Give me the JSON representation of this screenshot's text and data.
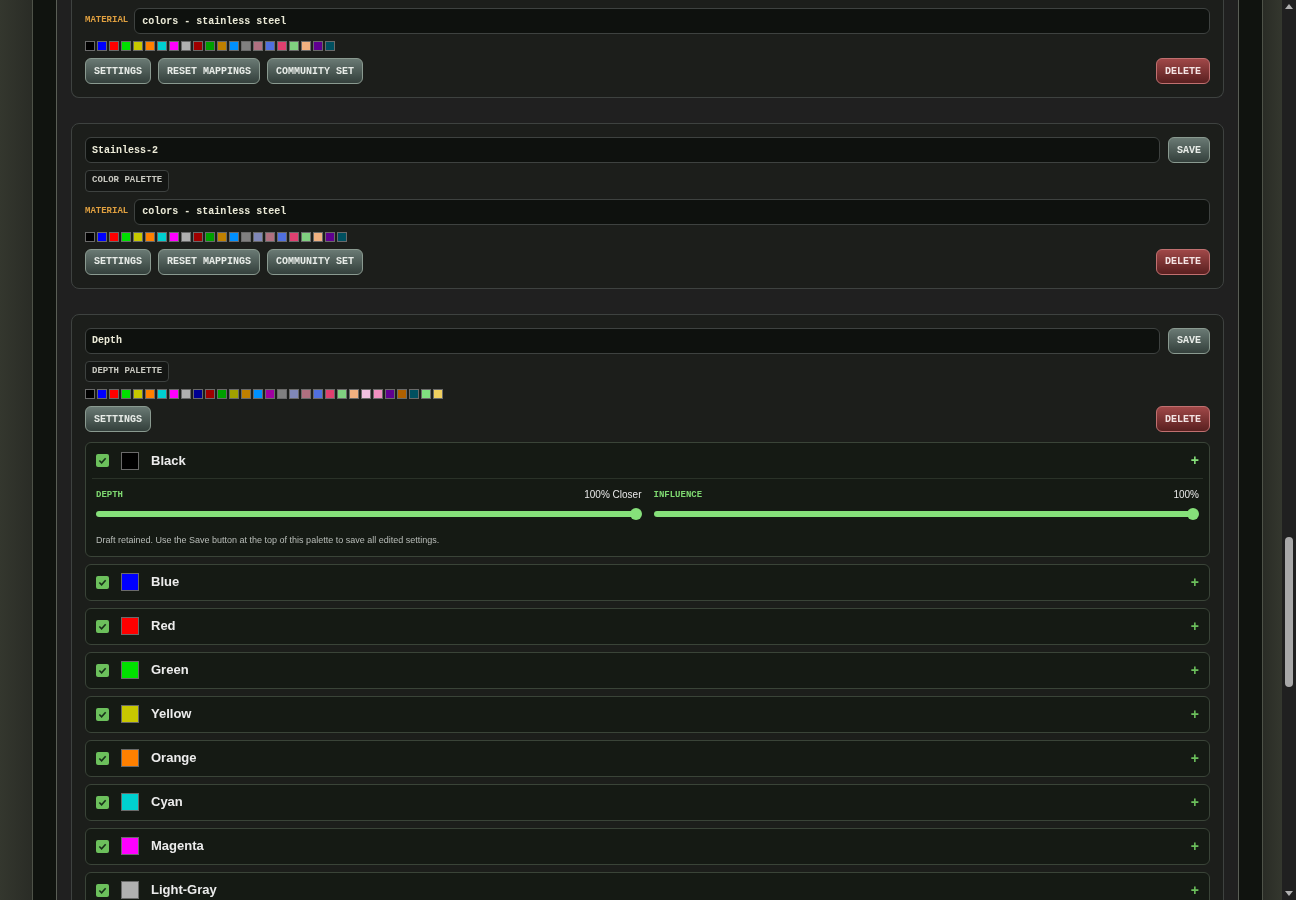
{
  "palettes": [
    {
      "kind": "material",
      "cut_top": true,
      "material_label": "MATERIAL",
      "material_value": "colors - stainless steel",
      "swatches": [
        {
          "color": "#000000"
        },
        {
          "color": "#0000ff"
        },
        {
          "color": "#ff0000"
        },
        {
          "color": "#00e000"
        },
        {
          "color": "#c8c800"
        },
        {
          "color": "#ff8000"
        },
        {
          "color": "#00d0d0"
        },
        {
          "color": "#ff00ff"
        },
        {
          "color": "#b0b0b0"
        },
        {
          "color": "#a00000"
        },
        {
          "color": "#00a000"
        },
        {
          "color": "#c08000"
        },
        {
          "color": "#0090ff"
        },
        {
          "color": "#808080"
        },
        {
          "color": "#b07080"
        },
        {
          "color": "#5070e0"
        },
        {
          "color": "#e04070"
        },
        {
          "color": "#80d080"
        },
        {
          "color": "#f0b080"
        },
        {
          "color": "#600090"
        },
        {
          "color": "#005060"
        }
      ],
      "buttons": [
        "SETTINGS",
        "RESET MAPPINGS",
        "COMMUNITY SET"
      ],
      "delete": "DELETE"
    },
    {
      "kind": "material",
      "cut_top": false,
      "name": "Stainless-2",
      "save": "SAVE",
      "type_label": "COLOR PALETTE",
      "material_label": "MATERIAL",
      "material_value": "colors - stainless steel",
      "swatches": [
        {
          "color": "#000000"
        },
        {
          "color": "#0000ff"
        },
        {
          "color": "#ff0000"
        },
        {
          "color": "#00e000"
        },
        {
          "color": "#c8c800"
        },
        {
          "color": "#ff8000"
        },
        {
          "color": "#00d0d0"
        },
        {
          "color": "#ff00ff"
        },
        {
          "color": "#b0b0b0"
        },
        {
          "color": "#a00000"
        },
        {
          "color": "#00a000"
        },
        {
          "color": "#c08000"
        },
        {
          "color": "#0090ff"
        },
        {
          "color": "#808080"
        },
        {
          "color": "#8088b8"
        },
        {
          "color": "#b07080"
        },
        {
          "color": "#5070e0"
        },
        {
          "color": "#e04070"
        },
        {
          "color": "#80d080"
        },
        {
          "color": "#f0b080"
        },
        {
          "color": "#600090"
        },
        {
          "color": "#005060"
        }
      ],
      "buttons": [
        "SETTINGS",
        "RESET MAPPINGS",
        "COMMUNITY SET"
      ],
      "delete": "DELETE"
    },
    {
      "kind": "depth",
      "cut_top": false,
      "name": "Depth",
      "save": "SAVE",
      "type_label": "DEPTH PALETTE",
      "swatches": [
        {
          "color": "#000000"
        },
        {
          "color": "#0000ff"
        },
        {
          "color": "#ff0000"
        },
        {
          "color": "#00e000"
        },
        {
          "color": "#c8c800"
        },
        {
          "color": "#ff8000"
        },
        {
          "color": "#00d0d0"
        },
        {
          "color": "#ff00ff"
        },
        {
          "color": "#b0b0b0"
        },
        {
          "color": "#000090"
        },
        {
          "color": "#a00000"
        },
        {
          "color": "#00a000"
        },
        {
          "color": "#a0a000"
        },
        {
          "color": "#c08000"
        },
        {
          "color": "#0090ff"
        },
        {
          "color": "#a000a0"
        },
        {
          "color": "#808080"
        },
        {
          "color": "#8088b8"
        },
        {
          "color": "#b07080"
        },
        {
          "color": "#5070e0"
        },
        {
          "color": "#e04070"
        },
        {
          "color": "#80d080"
        },
        {
          "color": "#f0b080"
        },
        {
          "color": "#f0c0e0"
        },
        {
          "color": "#f090c0"
        },
        {
          "color": "#600090"
        },
        {
          "color": "#b06000"
        },
        {
          "color": "#005060"
        },
        {
          "color": "#80e080"
        },
        {
          "color": "#f0d060"
        }
      ],
      "buttons": [
        "SETTINGS"
      ],
      "delete": "DELETE",
      "colors": [
        {
          "name": "Black",
          "color": "#000000",
          "checked": true,
          "expanded": true,
          "toggle": "+",
          "depth": {
            "label": "DEPTH",
            "reading": "100% Closer",
            "level": 1
          },
          "influence": {
            "label": "INFLUENCE",
            "reading": "100%",
            "level": 1
          },
          "note": "Draft retained. Use the Save button at the top of this palette to save all edited settings."
        },
        {
          "name": "Blue",
          "color": "#0000ff",
          "checked": true,
          "expanded": false,
          "toggle": "+"
        },
        {
          "name": "Red",
          "color": "#ff0000",
          "checked": true,
          "expanded": false,
          "toggle": "+"
        },
        {
          "name": "Green",
          "color": "#00e000",
          "checked": true,
          "expanded": false,
          "toggle": "+"
        },
        {
          "name": "Yellow",
          "color": "#c8c800",
          "checked": true,
          "expanded": false,
          "toggle": "+"
        },
        {
          "name": "Orange",
          "color": "#ff8000",
          "checked": true,
          "expanded": false,
          "toggle": "+"
        },
        {
          "name": "Cyan",
          "color": "#00d0d0",
          "checked": true,
          "expanded": false,
          "toggle": "+"
        },
        {
          "name": "Magenta",
          "color": "#ff00ff",
          "checked": true,
          "expanded": false,
          "toggle": "+"
        },
        {
          "name": "Light-Gray",
          "color": "#b0b0b0",
          "checked": true,
          "expanded": false,
          "toggle": "+"
        }
      ]
    }
  ]
}
